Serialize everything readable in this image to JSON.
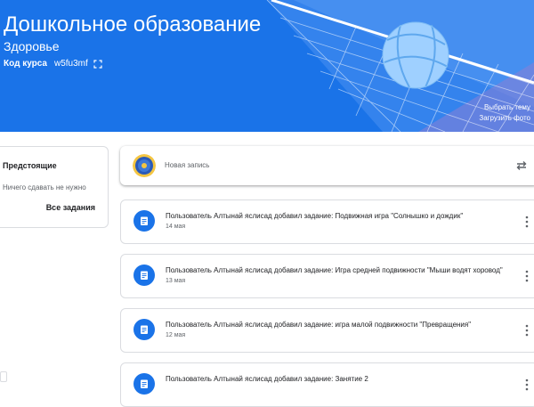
{
  "banner": {
    "title": "Дошкольное образование",
    "section": "Здоровье",
    "code_label": "Код курса",
    "code_value": "w5fu3mf",
    "select_theme": "Выбрать тему",
    "upload_photo": "Загрузить фото",
    "colors": {
      "background": "#1a73e8",
      "ball": "#9fd0ff"
    }
  },
  "upcoming": {
    "title": "Предстоящие",
    "empty_text": "Ничего сдавать не нужно",
    "all_link": "Все задания"
  },
  "announce": {
    "placeholder": "Новая запись"
  },
  "stream": [
    {
      "title": "Пользователь Алтынай яслисад добавил задание: Подвижная игра \"Солнышко и дождик\"",
      "date": "14 мая",
      "icon": "assignment-icon"
    },
    {
      "title": "Пользователь Алтынай яслисад добавил задание: Игра средней подвижности \"Мыши водят хоровод\"",
      "date": "13 мая",
      "icon": "assignment-icon"
    },
    {
      "title": "Пользователь Алтынай яслисад добавил задание: игра малой подвижности \"Превращения\"",
      "date": "12 мая",
      "icon": "assignment-icon"
    },
    {
      "title": "Пользователь Алтынай яслисад добавил задание: Занятие 2",
      "date": "",
      "icon": "assignment-icon"
    }
  ]
}
